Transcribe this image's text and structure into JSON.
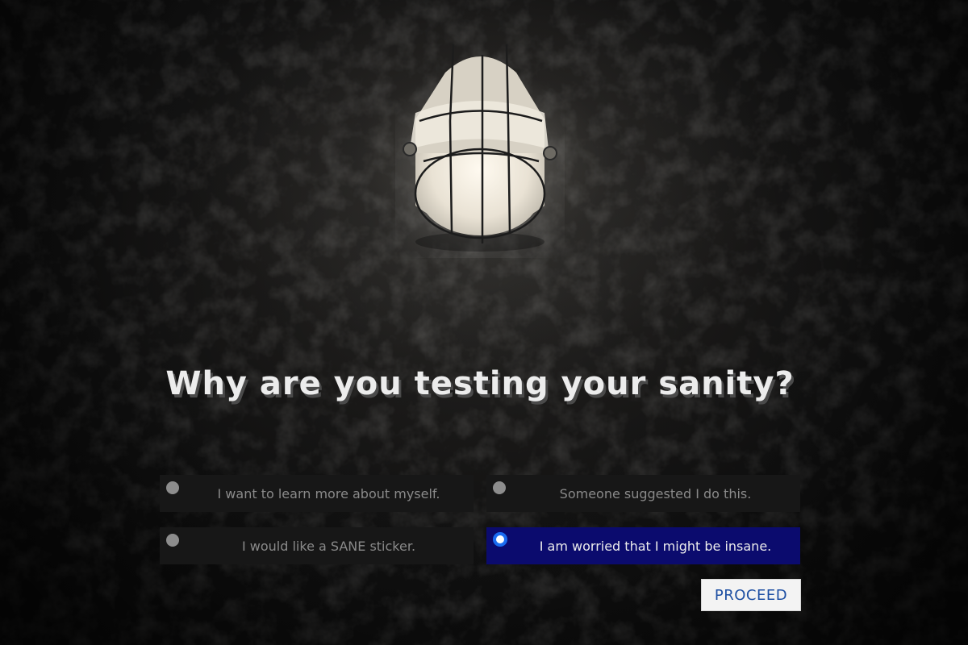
{
  "background": {
    "image": "dark-concrete-wall-with-caged-bulkhead-lamp"
  },
  "question": {
    "text": "Why are you testing your sanity?"
  },
  "options": [
    {
      "label": "I want to learn more about myself.",
      "selected": false
    },
    {
      "label": "Someone suggested I do this.",
      "selected": false
    },
    {
      "label": "I would like a SANE sticker.",
      "selected": false
    },
    {
      "label": "I am worried that I might be insane.",
      "selected": true
    }
  ],
  "actions": {
    "proceed_label": "PROCEED"
  },
  "colors": {
    "selected_option": "#0b0b6e",
    "radio_accent": "#1a6cf0",
    "button_text": "#1d4fa3"
  }
}
